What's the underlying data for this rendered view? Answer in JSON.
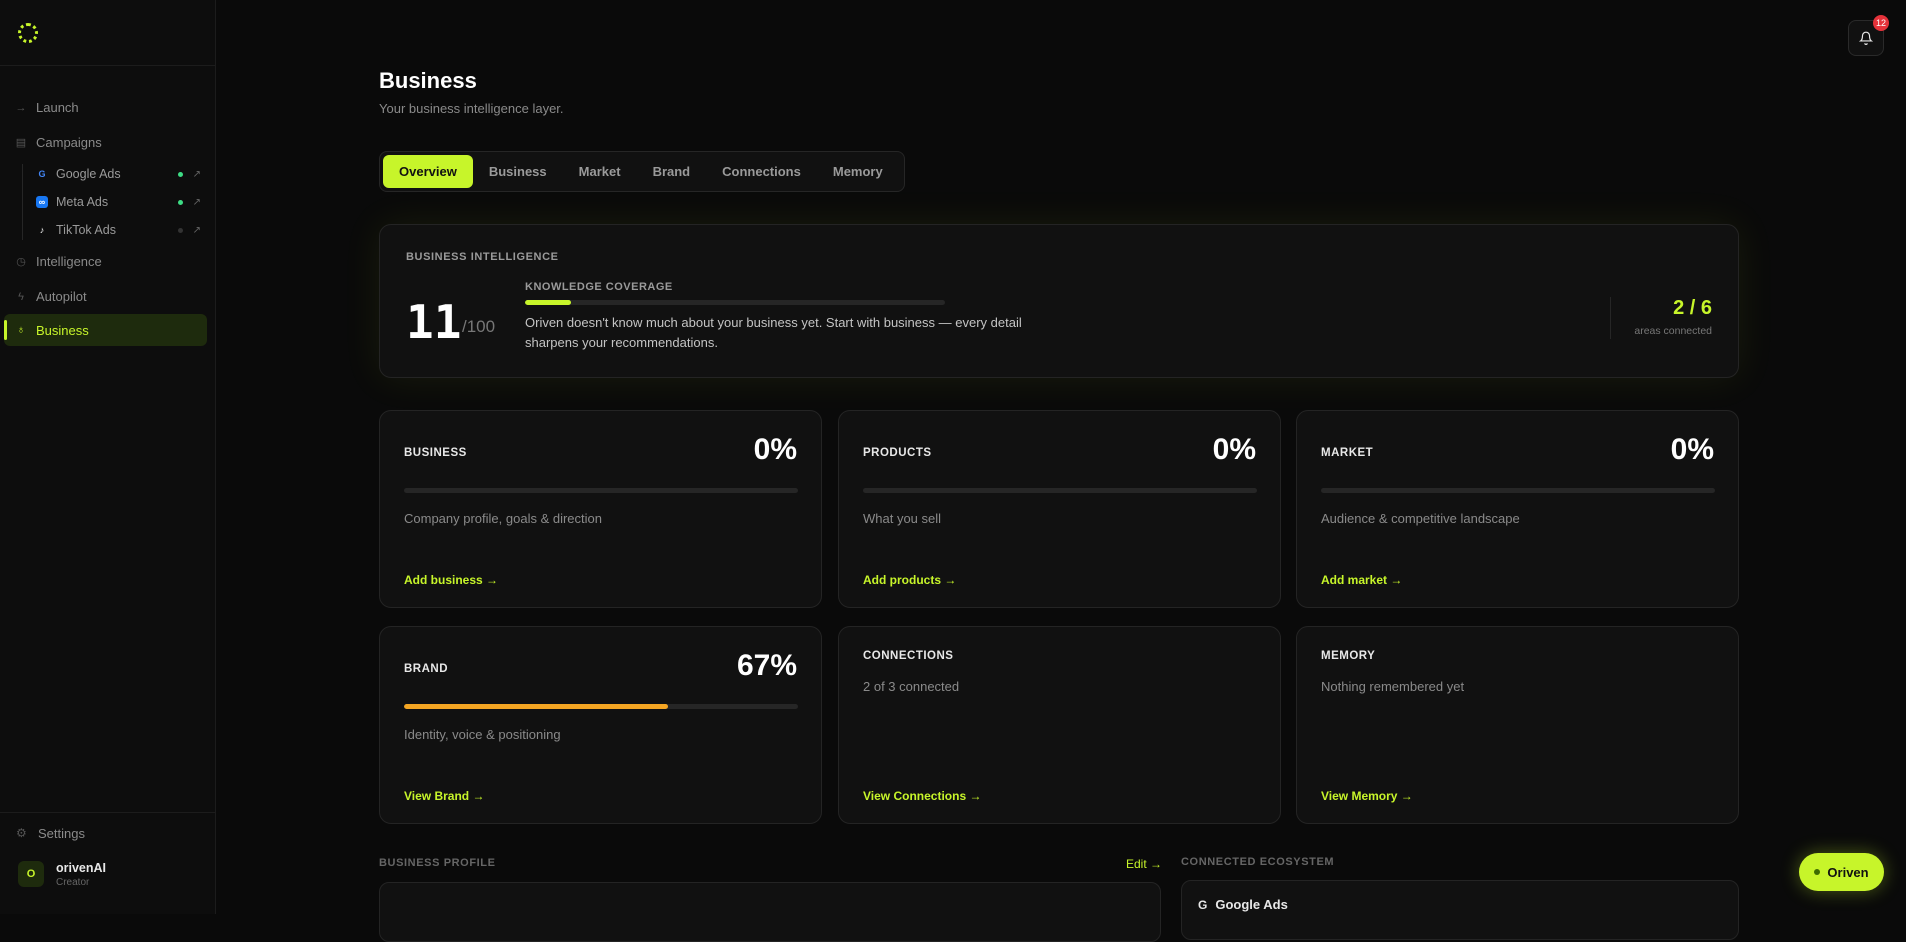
{
  "sidebar": {
    "items": [
      {
        "label": "Launch",
        "icon": "arrow-right-icon"
      },
      {
        "label": "Campaigns",
        "icon": "clipboard-icon"
      }
    ],
    "campaigns": [
      {
        "label": "Google Ads",
        "status": "active"
      },
      {
        "label": "Meta Ads",
        "status": "active"
      },
      {
        "label": "TikTok Ads",
        "status": "inactive"
      }
    ],
    "items2": [
      {
        "label": "Intelligence",
        "icon": "clock-icon"
      },
      {
        "label": "Autopilot",
        "icon": "bolt-icon"
      },
      {
        "label": "Business",
        "icon": "bulb-icon"
      }
    ],
    "settings": "Settings",
    "user": {
      "initial": "O",
      "name": "orivenAI",
      "role": "Creator"
    }
  },
  "header": {
    "title": "Business",
    "subtitle": "Your business intelligence layer.",
    "notification_count": "12"
  },
  "tabs": [
    "Overview",
    "Business",
    "Market",
    "Brand",
    "Connections",
    "Memory"
  ],
  "intelligence": {
    "label": "BUSINESS INTELLIGENCE",
    "score": "11",
    "score_max": "/100",
    "coverage_label": "KNOWLEDGE COVERAGE",
    "coverage_fraction": 0.11,
    "description": "Oriven doesn't know much about your business yet. Start with business — every detail sharpens your recommendations.",
    "areas_connected": "2 / 6",
    "areas_label": "areas connected"
  },
  "cards": [
    {
      "title": "BUSINESS",
      "pct": "0%",
      "fraction": 0,
      "desc": "Company profile, goals & direction",
      "link": "Add business →"
    },
    {
      "title": "PRODUCTS",
      "pct": "0%",
      "fraction": 0,
      "desc": "What you sell",
      "link": "Add products →"
    },
    {
      "title": "MARKET",
      "pct": "0%",
      "fraction": 0,
      "desc": "Audience & competitive landscape",
      "link": "Add market →"
    },
    {
      "title": "BRAND",
      "pct": "67%",
      "fraction": 0.67,
      "desc": "Identity, voice & positioning",
      "link": "View Brand →"
    },
    {
      "title": "CONNECTIONS",
      "desc": "2 of 3 connected",
      "link": "View Connections →"
    },
    {
      "title": "MEMORY",
      "desc": "Nothing remembered yet",
      "link": "View Memory →"
    }
  ],
  "bottom": {
    "profile_label": "BUSINESS PROFILE",
    "edit": "Edit →",
    "ecosystem_label": "CONNECTED ECOSYSTEM",
    "ecosystem_item": "Google Ads"
  },
  "assistant_button": "Oriven",
  "colors": {
    "accent": "#c7f52a",
    "brand_bar": "#f5a623",
    "active_dot": "#3ddc84",
    "badge": "#e5323a"
  }
}
